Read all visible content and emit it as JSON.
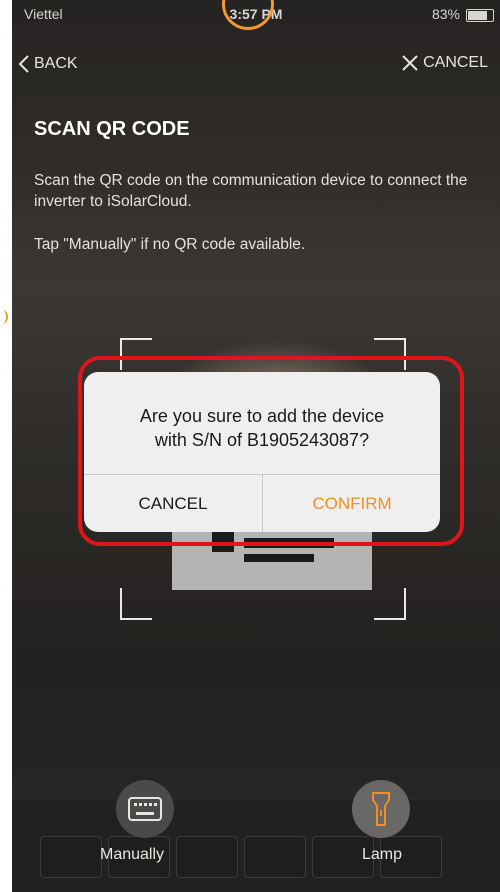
{
  "status_bar": {
    "carrier": "Viettel",
    "time": "3:57 PM",
    "battery": "83%"
  },
  "nav": {
    "back_label": "BACK",
    "cancel_label": "CANCEL"
  },
  "page": {
    "title": "SCAN QR CODE",
    "description": "Scan the QR code on the communication device to connect the inverter to iSolarCloud.",
    "tip": "Tap \"Manually\" if no QR code available."
  },
  "dialog": {
    "message_line1": "Are you sure to add the device",
    "message_line2": "with S/N of B1905243087?",
    "cancel_label": "CANCEL",
    "confirm_label": "CONFIRM"
  },
  "tools": {
    "manual_label": "Manually",
    "lamp_label": "Lamp"
  },
  "colors": {
    "accent": "#f0901e",
    "highlight": "#e0141b"
  }
}
